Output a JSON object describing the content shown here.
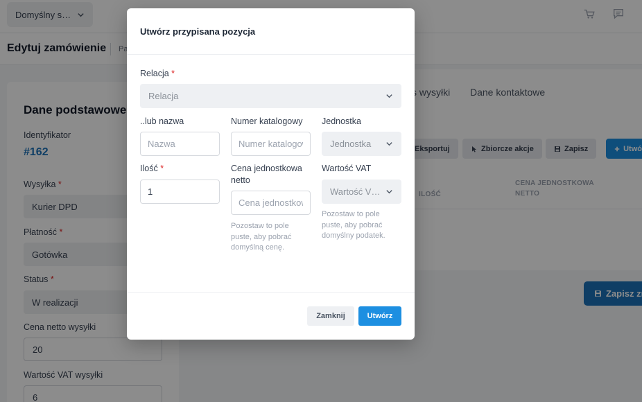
{
  "topbar": {
    "store_select": "Domyślny s…",
    "icons": [
      "chevron-down-icon",
      "cart-icon",
      "chat-icon"
    ]
  },
  "subheader": {
    "title": "Edytuj zamówienie",
    "breadcrumb": "Pa"
  },
  "left_card": {
    "title": "Dane podstawowe",
    "id_label": "Identyfikator",
    "id_value": "#162",
    "shipping_label": "Wysyłka",
    "shipping_value": "Kurier DPD",
    "payment_label": "Płatność",
    "payment_value": "Gotówka",
    "status_label": "Status",
    "status_value": "W realizacji",
    "ship_net_label": "Cena netto wysyłki",
    "ship_net_value": "20",
    "ship_vat_label": "Wartość VAT wysyłki",
    "ship_vat_value": "6",
    "required_mark": "*"
  },
  "right_card": {
    "tabs": [
      "s wysyłki",
      "Dane kontaktowe"
    ],
    "toolbar": {
      "export": "Eksportuj",
      "bulk": "Zbiorcze akcje",
      "save": "Zapisz",
      "create": "Utwó"
    },
    "columns": {
      "qty": "ILOŚĆ",
      "unit_price_line1": "CENA JEDNOSTKOWA",
      "unit_price_line2": "NETTO"
    }
  },
  "save_changes": "Zapisz zm",
  "modal": {
    "title": "Utwórz przypisana pozycja",
    "relation_label": "Relacja",
    "relation_placeholder": "Relacja",
    "name_label": "..lub nazwa",
    "name_placeholder": "Nazwa",
    "catalog_label": "Numer katalogowy",
    "catalog_placeholder": "Numer katalogowy",
    "unit_label": "Jednostka",
    "unit_placeholder": "Jednostka",
    "qty_label": "Ilość",
    "qty_value": "1",
    "unit_price_label_line1": "Cena jednostkowa",
    "unit_price_label_line2": "netto",
    "unit_price_placeholder": "Cena jednostkowa",
    "unit_price_hint": [
      "Pozostaw to pole",
      "puste, aby pobrać",
      "domyślną cenę."
    ],
    "vat_label": "Wartość VAT",
    "vat_placeholder": "Wartość V…",
    "vat_hint": [
      "Pozostaw to pole",
      "puste, aby pobrać",
      "domyślny podatek."
    ],
    "required_mark": "*",
    "close_button": "Zamknij",
    "create_button": "Utwórz"
  }
}
